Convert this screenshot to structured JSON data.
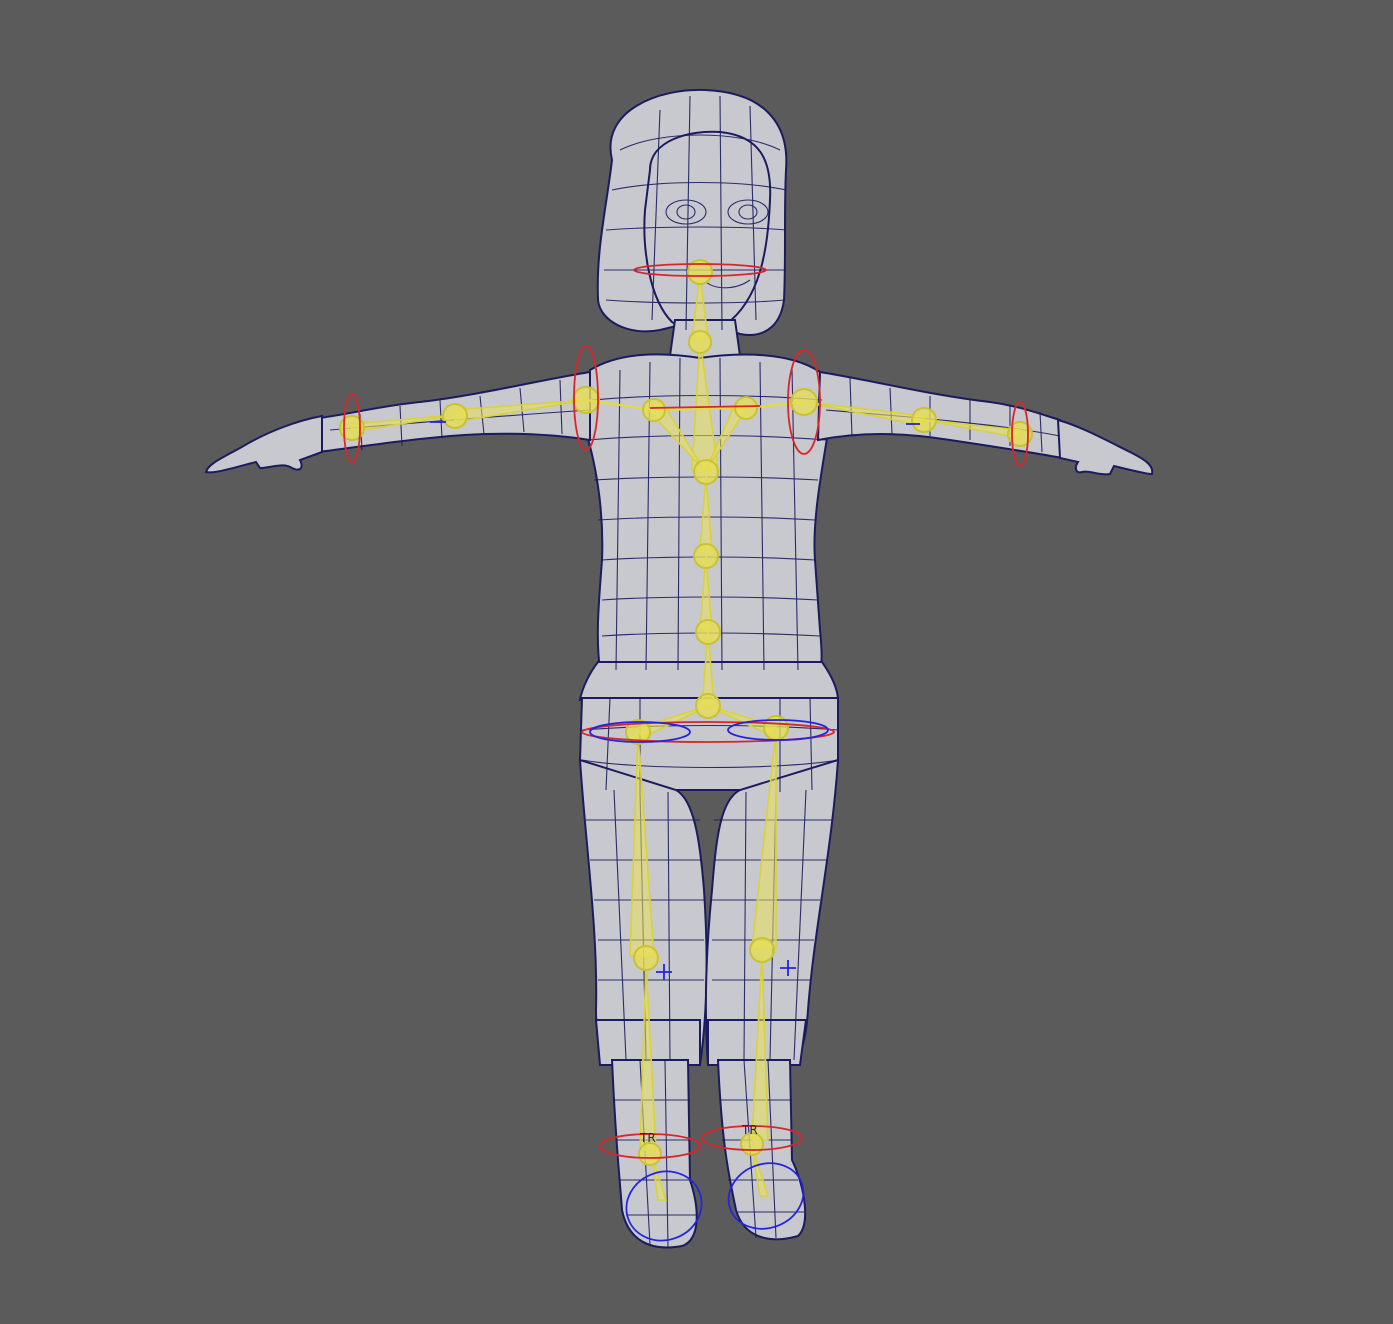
{
  "viewport": {
    "background": "#5b5b5b",
    "mesh_color": "#c8c8cf",
    "wire_color": "#1b1b5e",
    "joint_color": "#e6df55",
    "red_control_color": "#d8262a",
    "blue_control_color": "#2424e0"
  },
  "labels": {
    "left_ankle_ctrl": "TR",
    "right_ankle_ctrl": "TR"
  }
}
